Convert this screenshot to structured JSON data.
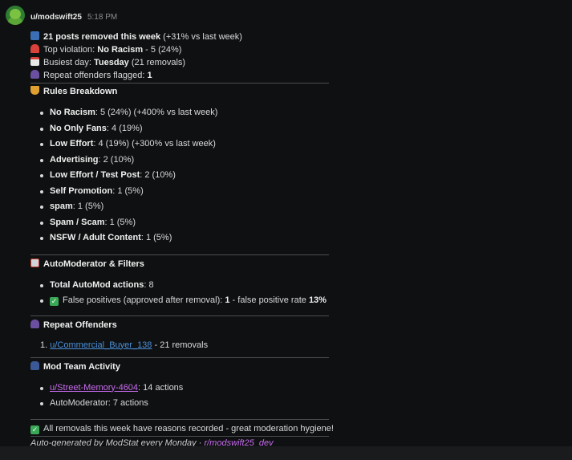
{
  "message": {
    "username": "u/modswift25",
    "time": "5:18 PM"
  },
  "summary": {
    "removed_count": "21 posts removed this week",
    "removed_delta": " (+31% vs last week)",
    "top_violation_label": "Top violation: ",
    "top_violation_value": "No Racism",
    "top_violation_detail": " - 5 (24%)",
    "busiest_label": "Busiest day: ",
    "busiest_value": "Tuesday",
    "busiest_detail": " (21 removals)",
    "repeat_label": "Repeat offenders flagged: ",
    "repeat_value": "1"
  },
  "rules": {
    "title": "Rules Breakdown",
    "items": [
      {
        "name": "No Racism",
        "detail": ": 5 (24%) (+400% vs last week)"
      },
      {
        "name": "No Only Fans",
        "detail": ": 4 (19%)"
      },
      {
        "name": "Low Effort",
        "detail": ": 4 (19%) (+300% vs last week)"
      },
      {
        "name": "Advertising",
        "detail": ": 2 (10%)"
      },
      {
        "name": "Low Effort / Test Post",
        "detail": ": 2 (10%)"
      },
      {
        "name": "Self Promotion",
        "detail": ": 1 (5%)"
      },
      {
        "name": "spam",
        "detail": ": 1 (5%)"
      },
      {
        "name": "Spam / Scam",
        "detail": ": 1 (5%)"
      },
      {
        "name": "NSFW / Adult Content",
        "detail": ": 1 (5%)"
      }
    ]
  },
  "automod": {
    "title": "AutoModerator & Filters",
    "total_label": "Total AutoMod actions",
    "total_value": ": 8",
    "fp_label": "False positives (approved after removal): ",
    "fp_value": "1",
    "fp_mid": " - false positive rate ",
    "fp_rate": "13%"
  },
  "offenders": {
    "title": "Repeat Offenders",
    "items": [
      {
        "num": "1.",
        "user": "u/Commercial_Buyer_138",
        "detail": " - 21 removals"
      }
    ]
  },
  "team": {
    "title": "Mod Team Activity",
    "items": [
      {
        "user": "u/Street-Memory-4604",
        "detail": ": 14 actions"
      },
      {
        "user": "AutoModerator",
        "detail": ": 7 actions"
      }
    ]
  },
  "closing": "All removals this week have reasons recorded - great moderation hygiene!",
  "footer": {
    "text": "Auto-generated by ModStat every Monday · ",
    "subreddit": "r/modswift25_dev"
  },
  "icons": {
    "chart": "bar-chart-icon",
    "siren": "siren-icon",
    "calendar": "calendar-icon",
    "person": "person-silhouette-icon",
    "scales": "scales-icon",
    "robot": "robot-icon",
    "police": "police-officer-icon",
    "check": "check-mark-icon"
  },
  "colors": {
    "link": "#4a90d9",
    "mention": "#c86cf0",
    "check": "#3aa857"
  }
}
